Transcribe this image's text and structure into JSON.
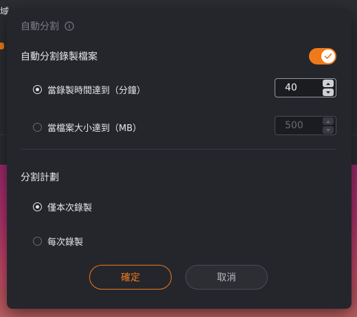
{
  "background": {
    "tab_text": "域"
  },
  "dialog": {
    "title": "自動分割",
    "auto_split_label": "自動分割錄製檔案",
    "auto_split_enabled": true,
    "options": [
      {
        "label": "當錄製時間達到（分鐘）",
        "value": "40",
        "checked": true
      },
      {
        "label": "當檔案大小達到（MB）",
        "value": "500",
        "checked": false
      }
    ],
    "plan_title": "分割計劃",
    "plans": [
      {
        "label": "僅本次錄製",
        "checked": true
      },
      {
        "label": "每次錄製",
        "checked": false
      }
    ],
    "confirm_label": "確定",
    "cancel_label": "取消"
  },
  "colors": {
    "accent": "#f07a1a",
    "dialog_bg": "#25262c"
  }
}
